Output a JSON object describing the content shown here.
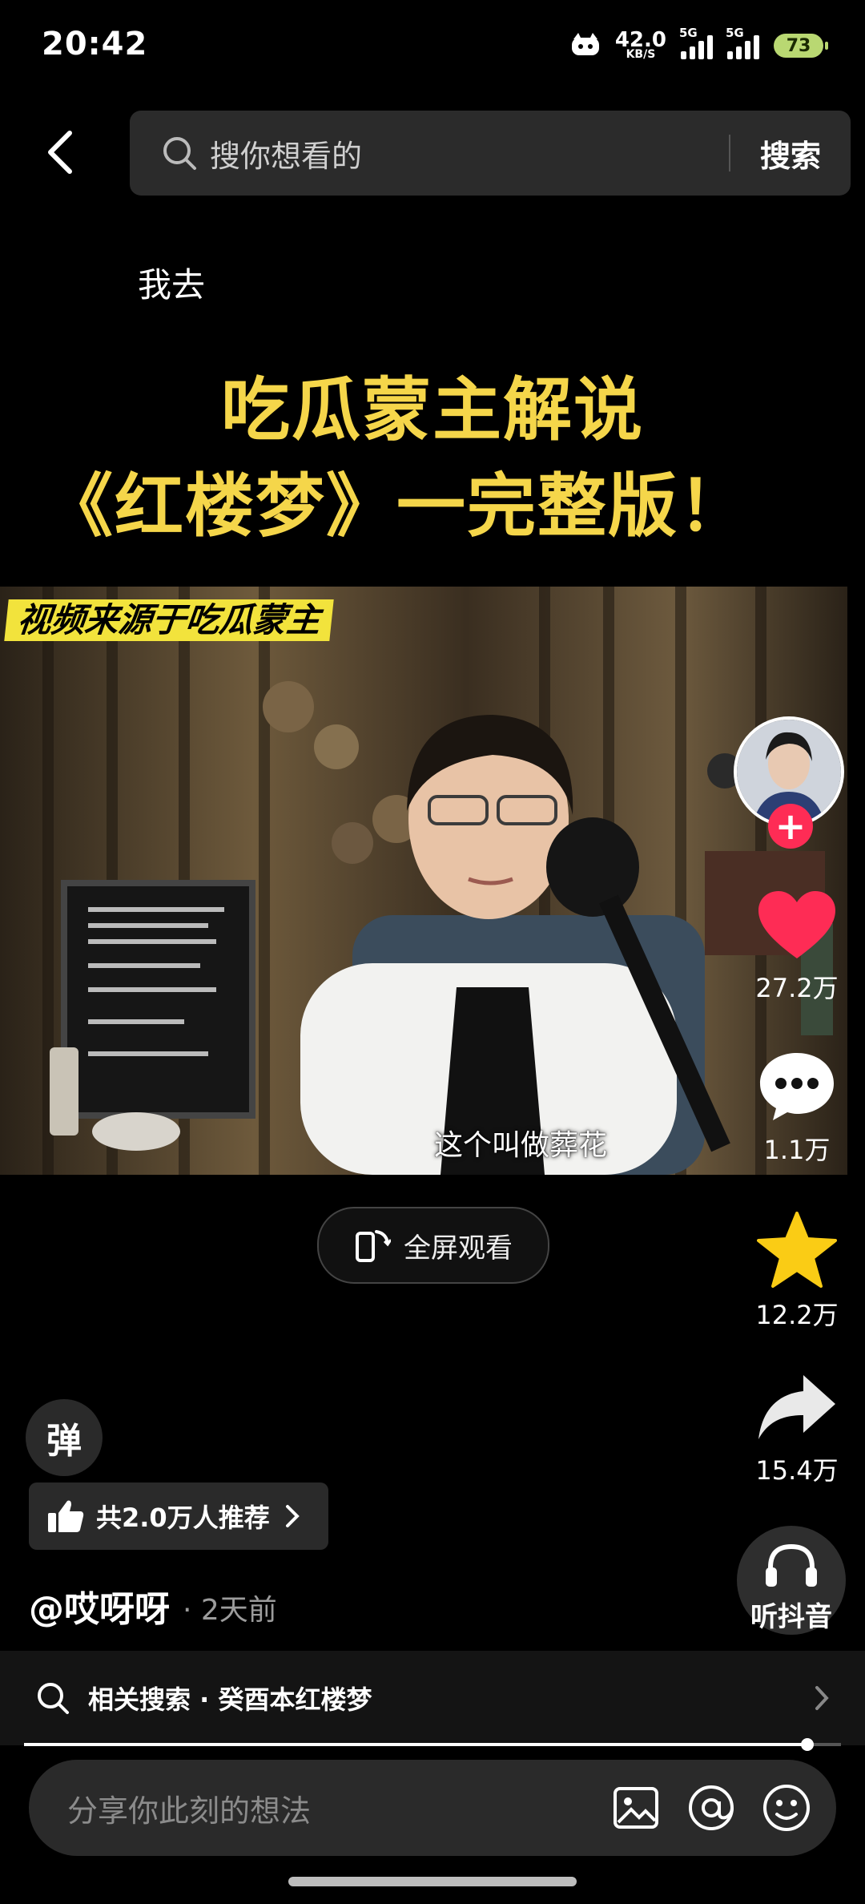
{
  "status_bar": {
    "time": "20:42",
    "net_speed": "42.0",
    "net_unit": "KB/S",
    "sim1_label": "5G",
    "sim2_label": "5G",
    "battery": "73"
  },
  "header": {
    "back_icon": "chevron-left-icon",
    "search_placeholder": "搜你想看的",
    "search_button": "搜索"
  },
  "video": {
    "top_caption": "我去",
    "title_line1": "吃瓜蒙主解说",
    "title_line2": "《红楼梦》一完整版！",
    "source_tag": "视频来源于吃瓜蒙主",
    "subtitle": "这个叫做葬花",
    "fullscreen_label": "全屏观看"
  },
  "actions": {
    "like_count": "27.2万",
    "comment_count": "1.1万",
    "favorite_count": "12.2万",
    "share_count": "15.4万",
    "listen_label": "听抖音",
    "colors": {
      "like": "#fe2c55",
      "favorite": "#facc15"
    }
  },
  "meta": {
    "danmaku_label": "弹",
    "recommend_text": "共2.0万人推荐",
    "author": "@哎呀呀",
    "time_ago": "· 2天前"
  },
  "related": {
    "text": "相关搜索 · 癸酉本红楼梦"
  },
  "playback": {
    "progress": 0.96
  },
  "comment_bar": {
    "placeholder": "分享你此刻的想法"
  }
}
